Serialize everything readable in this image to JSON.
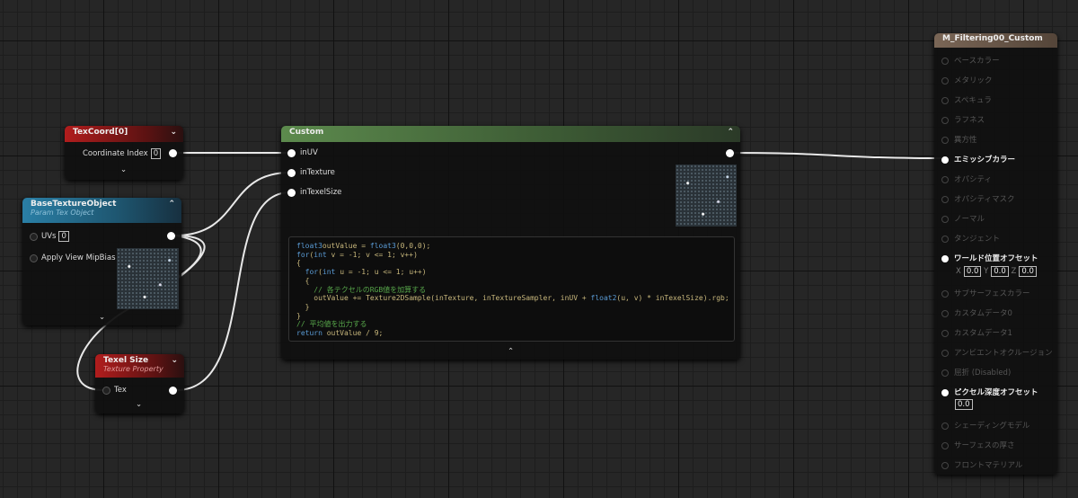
{
  "texcoord": {
    "title": "TexCoord[0]",
    "label": "Coordinate Index",
    "value": "0"
  },
  "base_texture": {
    "title": "BaseTextureObject",
    "subtitle": "Param Tex Object",
    "uvs_label": "UVs",
    "uvs_value": "0",
    "mip_label": "Apply View MipBias"
  },
  "texel_size": {
    "title": "Texel Size",
    "subtitle": "Texture Property",
    "tex_label": "Tex"
  },
  "custom": {
    "title": "Custom",
    "inputs": [
      "inUV",
      "inTexture",
      "inTexelSize"
    ],
    "code": [
      [
        [
          "kw",
          "float3"
        ],
        [
          "",
          "outValue = "
        ],
        [
          "kw",
          "float3"
        ],
        [
          "",
          "(0,0,0);"
        ]
      ],
      [
        [
          "kw",
          "for"
        ],
        [
          "",
          "("
        ],
        [
          "kw",
          "int"
        ],
        [
          "",
          " v = -1; v <= 1; v++)"
        ]
      ],
      [
        [
          "",
          "{"
        ]
      ],
      [
        [
          "",
          "  "
        ],
        [
          "kw",
          "for"
        ],
        [
          "",
          "("
        ],
        [
          "kw",
          "int"
        ],
        [
          "",
          " u = -1; u <= 1; u++)"
        ]
      ],
      [
        [
          "",
          "  {"
        ]
      ],
      [
        [
          "cm",
          "    // 各テクセルのRGB値を加算する"
        ]
      ],
      [
        [
          "",
          "    outValue += Texture2DSample(inTexture, inTextureSampler, inUV + "
        ],
        [
          "kw",
          "float2"
        ],
        [
          "",
          "(u, v) * inTexelSize).rgb;"
        ]
      ],
      [
        [
          "",
          "  }"
        ]
      ],
      [
        [
          "",
          "}"
        ]
      ],
      [
        [
          "cm",
          "// 平均値を出力する"
        ]
      ],
      [
        [
          "kw",
          "return"
        ],
        [
          "",
          " outValue / 9;"
        ]
      ]
    ]
  },
  "result": {
    "title": "M_Filtering00_Custom",
    "pins": [
      {
        "label": "ベースカラー",
        "active": false
      },
      {
        "label": "メタリック",
        "active": false
      },
      {
        "label": "スペキュラ",
        "active": false
      },
      {
        "label": "ラフネス",
        "active": false
      },
      {
        "label": "異方性",
        "active": false
      },
      {
        "label": "エミッシブカラー",
        "active": true
      },
      {
        "label": "オパシティ",
        "active": false
      },
      {
        "label": "オパシティマスク",
        "active": false
      },
      {
        "label": "ノーマル",
        "active": false
      },
      {
        "label": "タンジェント",
        "active": false
      },
      {
        "label": "ワールド位置オフセット",
        "active": true
      },
      {
        "label": "サブサーフェスカラー",
        "active": false
      },
      {
        "label": "カスタムデータ0",
        "active": false
      },
      {
        "label": "カスタムデータ1",
        "active": false
      },
      {
        "label": "アンビエントオクルージョン",
        "active": false
      },
      {
        "label": "屈折 (Disabled)",
        "active": false
      },
      {
        "label": "ピクセル深度オフセット",
        "active": true
      },
      {
        "label": "シェーディングモデル",
        "active": false
      },
      {
        "label": "サーフェスの厚さ",
        "active": false
      },
      {
        "label": "フロントマテリアル",
        "active": false
      }
    ],
    "wpo": {
      "x_label": "X",
      "x": "0.0",
      "y_label": "Y",
      "y": "0.0",
      "z_label": "Z",
      "z": "0.0"
    },
    "pdo_value": "0.0"
  }
}
